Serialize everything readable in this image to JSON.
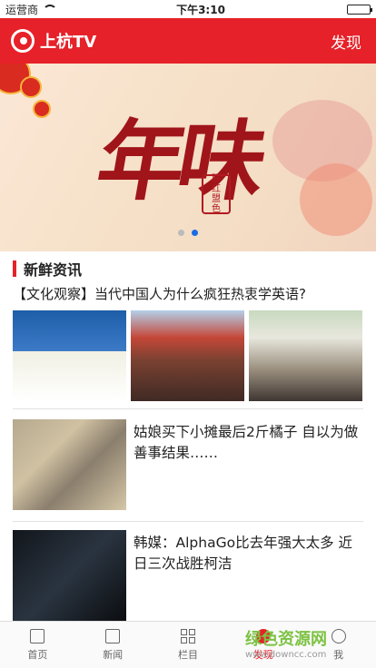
{
  "status_bar": {
    "carrier": "运营商",
    "time": "下午3:10",
    "battery_level": 1.0
  },
  "header": {
    "app_name": "上杭TV",
    "discover_label": "发现",
    "brand_color": "#e62129"
  },
  "banner": {
    "title": "年味",
    "seal_text": [
      "联",
      "红",
      "盟",
      "色"
    ],
    "page_count": 2,
    "active_page": 2
  },
  "section": {
    "title": "新鲜资讯"
  },
  "articles": [
    {
      "title": "【文化观察】当代中国人为什么疯狂热衷学英语?",
      "images": [
        "kids-classroom",
        "crowd-square",
        "students-walking"
      ]
    },
    {
      "title": "姑娘买下小摊最后2斤橘子 自以为做善事结果……",
      "image": "banknotes"
    },
    {
      "title": "韩媒：AlphaGo比去年强大太多 近日三次战胜柯洁",
      "image": "robot-hand"
    }
  ],
  "tabbar": {
    "items": [
      {
        "label": "首页",
        "icon": "home-icon"
      },
      {
        "label": "新闻",
        "icon": "news-icon"
      },
      {
        "label": "栏目",
        "icon": "grid-icon"
      },
      {
        "label": "发现",
        "icon": "compass-icon",
        "active": true
      },
      {
        "label": "我",
        "icon": "person-icon"
      }
    ]
  },
  "watermark": {
    "title": "绿色资源网",
    "url": "www.downcc.com"
  }
}
